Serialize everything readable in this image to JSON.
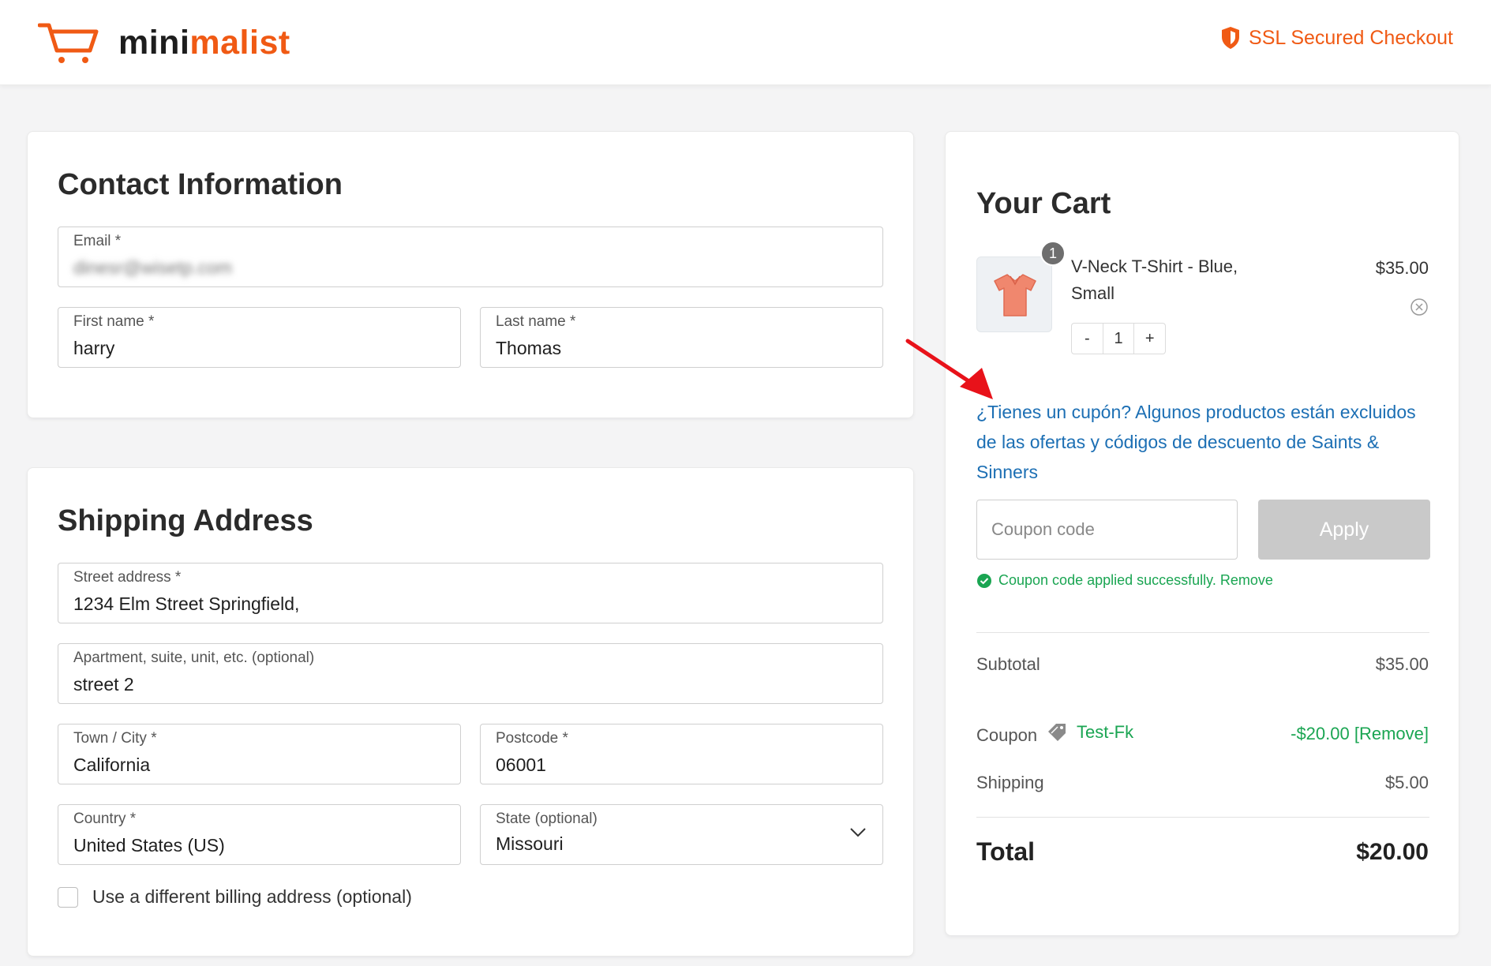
{
  "brand": {
    "logo_part1": "mini",
    "logo_part2": "malist",
    "accent_color": "#f05a14"
  },
  "header": {
    "secure_label": "SSL Secured Checkout",
    "secure_icon": "shield-icon"
  },
  "contact": {
    "title": "Contact Information",
    "email": {
      "label": "Email *",
      "value": "dinesr@wisetp.com"
    },
    "first_name": {
      "label": "First name *",
      "value": "harry"
    },
    "last_name": {
      "label": "Last name *",
      "value": "Thomas"
    }
  },
  "shipping": {
    "title": "Shipping Address",
    "street": {
      "label": "Street address *",
      "value": "1234 Elm Street Springfield,"
    },
    "apartment": {
      "label": "Apartment, suite, unit, etc. (optional)",
      "value": "street 2"
    },
    "city": {
      "label": "Town / City *",
      "value": "California"
    },
    "postcode": {
      "label": "Postcode *",
      "value": "06001"
    },
    "country": {
      "label": "Country *",
      "value": "United States (US)"
    },
    "state": {
      "label": "State (optional)",
      "value": "Missouri"
    },
    "billing_checkbox_label": "Use a different billing address (optional)"
  },
  "cart": {
    "title": "Your Cart",
    "item": {
      "quantity_badge": "1",
      "name": "V-Neck T-Shirt - Blue, Small",
      "price": "$35.00",
      "stepper": {
        "minus": "-",
        "qty": "1",
        "plus": "+"
      }
    },
    "coupon_prompt": "¿Tienes un cupón? Algunos productos están excluidos de las ofertas y códigos de descuento de Saints & Sinners",
    "coupon_placeholder": "Coupon code",
    "apply_label": "Apply",
    "success_message": "Coupon code applied successfully. Remove",
    "subtotal": {
      "label": "Subtotal",
      "value": "$35.00"
    },
    "coupon": {
      "label": "Coupon",
      "code": "Test-Fk",
      "value": "-$20.00 [Remove]"
    },
    "shipping": {
      "label": "Shipping",
      "value": "$5.00"
    },
    "total": {
      "label": "Total",
      "value": "$20.00"
    }
  }
}
